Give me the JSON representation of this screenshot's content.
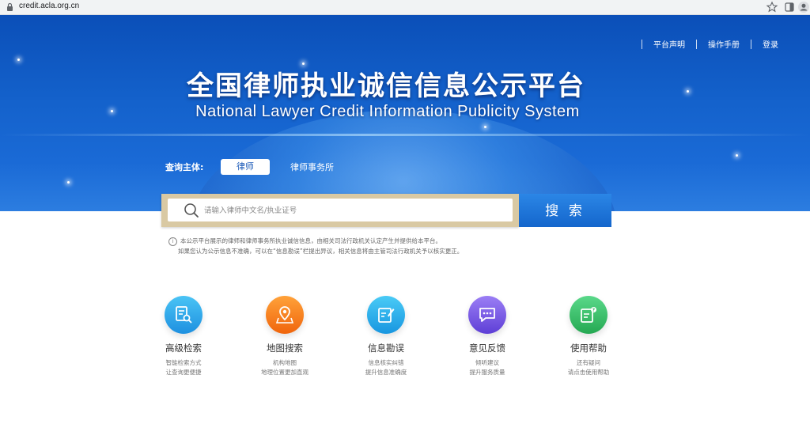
{
  "browser": {
    "url": "credit.acla.org.cn"
  },
  "header": {
    "nav": [
      "平台声明",
      "操作手册",
      "登录"
    ],
    "title": "全国律师执业诚信信息公示平台",
    "subtitle": "National Lawyer Credit Information Publicity System"
  },
  "search": {
    "subject_label": "查询主体:",
    "tabs": [
      "律师",
      "律师事务所"
    ],
    "active_tab": "律师",
    "placeholder": "请输入律师中文名/执业证号",
    "value": "",
    "button_label": "搜 索"
  },
  "notice": {
    "icon": "info-icon",
    "line1": "本公示平台展示的律师和律师事务所执业诚信信息，由相关司法行政机关认定产生并提供给本平台。",
    "line2": "如果您认为公示信息不准确，可以在“信息勘误”栏提出异议，相关信息将由主管司法行政机关予以核实更正。"
  },
  "features": [
    {
      "icon": "advanced-search-icon",
      "title": "高级检索",
      "desc1": "智能检索方式",
      "desc2": "让查询更便捷",
      "color": "#2aa8e8"
    },
    {
      "icon": "map-pin-icon",
      "title": "地图搜索",
      "desc1": "机构地图",
      "desc2": "地理位置更加直观",
      "color": "#f57c14"
    },
    {
      "icon": "edit-info-icon",
      "title": "信息勘误",
      "desc1": "信息核实纠错",
      "desc2": "提升信息准确度",
      "color": "#22b0e8"
    },
    {
      "icon": "feedback-icon",
      "title": "意见反馈",
      "desc1": "倾听建议",
      "desc2": "提升服务质量",
      "color": "#7a5ae0"
    },
    {
      "icon": "help-icon",
      "title": "使用帮助",
      "desc1": "还有疑问",
      "desc2": "请点击使用帮助",
      "color": "#3cc46a"
    }
  ]
}
